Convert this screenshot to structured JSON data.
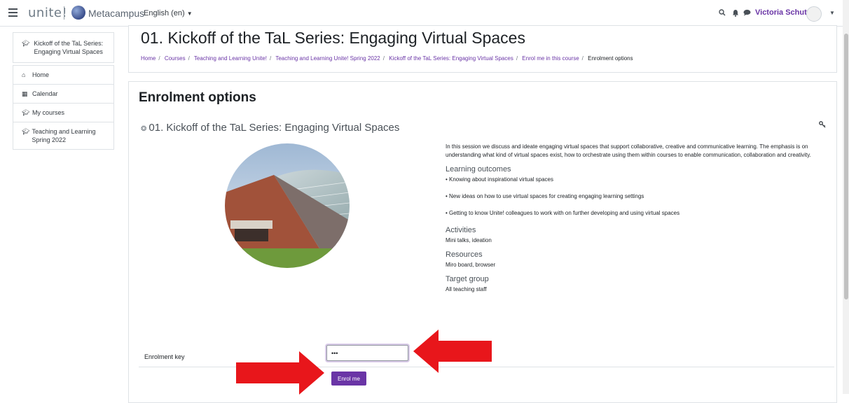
{
  "topbar": {
    "logo": "unite!",
    "brand": "Metacampus",
    "language": "English (en)",
    "user_name": "Victoria Schutz"
  },
  "sidebar": {
    "course": "Kickoff of the TaL Series: Engaging Virtual Spaces",
    "items": [
      {
        "label": "Home",
        "icon": "home-icon"
      },
      {
        "label": "Calendar",
        "icon": "calendar-icon"
      },
      {
        "label": "My courses",
        "icon": "graduation-cap-icon"
      },
      {
        "label": "Teaching and Learning Spring 2022",
        "icon": "graduation-cap-icon"
      }
    ]
  },
  "header": {
    "title": "01. Kickoff of the TaL Series: Engaging Virtual Spaces",
    "breadcrumb": [
      "Home",
      "Courses",
      "Teaching and Learning Unite!",
      "Teaching and Learning Unite! Spring 2022",
      "Kickoff of the TaL Series: Engaging Virtual Spaces",
      "Enrol me in this course"
    ],
    "breadcrumb_current": "Enrolment options"
  },
  "main": {
    "heading": "Enrolment options",
    "course_title": "01. Kickoff of the TaL Series: Engaging Virtual Spaces",
    "description": "In this session we discuss and ideate engaging virtual spaces that support collaborative, creative and communicative learning. The emphasis is on understanding what kind of virtual spaces exist, how to orchestrate using them within courses to enable communication, collaboration and creativity.",
    "outcomes_heading": "Learning outcomes",
    "outcomes": [
      "• Knowing about inspirational virtual spaces",
      "• New ideas on how to use virtual spaces for creating engaging learning settings",
      "• Getting to know Unite! colleagues to work with on further developing and using virtual spaces"
    ],
    "activities_heading": "Activities",
    "activities": "Mini talks, ideation",
    "resources_heading": "Resources",
    "resources": "Miro board, browser",
    "target_heading": "Target group",
    "target": "All teaching staff",
    "enrol_key_label": "Enrolment key",
    "enrol_key_value": "•••",
    "enrol_button": "Enrol me"
  },
  "colors": {
    "accent": "#6a35a6",
    "annotation_arrow": "#e8161b"
  }
}
